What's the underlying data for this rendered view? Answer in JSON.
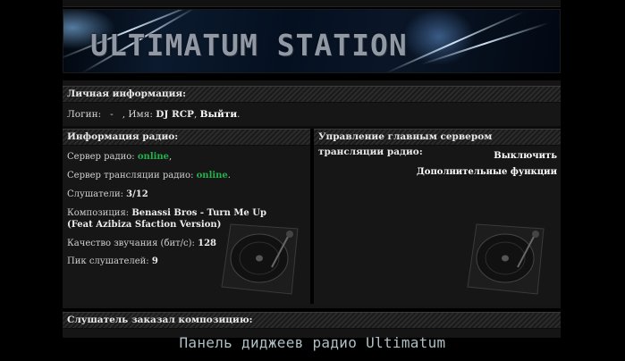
{
  "banner": {
    "title": "ULTIMATUM STATION"
  },
  "personal": {
    "header": "Личная информация:",
    "login_label": "Логин:",
    "login_value": "-",
    "name_label": ", Имя:",
    "name_value": "DJ RCP",
    "logout_label": "Выйти",
    "end": "."
  },
  "radio_info": {
    "header": "Информация радио:",
    "server_label": "Сервер радио:",
    "server_status": "online",
    "server_end": ",",
    "stream_label": "Сервер трансляции радио:",
    "stream_status": "online",
    "stream_end": ".",
    "listeners_label": "Слушатели:",
    "listeners_value": "3/12",
    "track_label": "Композиция:",
    "track_value": "Benassi Bros - Turn Me Up (Feat Azibiza Sfaction Version)",
    "quality_label": "Качество звучания (бит/с):",
    "quality_value": "128",
    "peak_label": "Пик слушателей:",
    "peak_value": "9"
  },
  "server_control": {
    "header": "Управление главным сервером трансляции радио:",
    "turn_off": "Выключить",
    "extra_functions": "Дополнительные функции"
  },
  "request": {
    "header": "Слушатель заказал композицию:"
  },
  "footer": {
    "caption": "Панель диджеев радио Ultimatum"
  },
  "icons": {
    "turntable": "turntable-icon"
  },
  "colors": {
    "online": "#22b14c",
    "background": "#000000",
    "panel": "#161616"
  }
}
